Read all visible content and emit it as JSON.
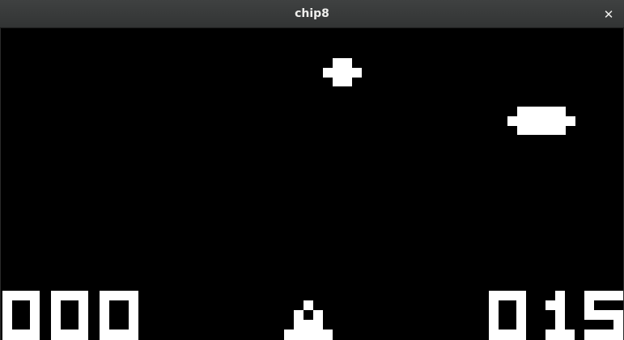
{
  "window": {
    "title": "chip8",
    "close_icon": "close-icon"
  },
  "game": {
    "background_color": "#000000",
    "pixel_color": "#ffffff",
    "score_left": "000",
    "score_right": "015"
  }
}
